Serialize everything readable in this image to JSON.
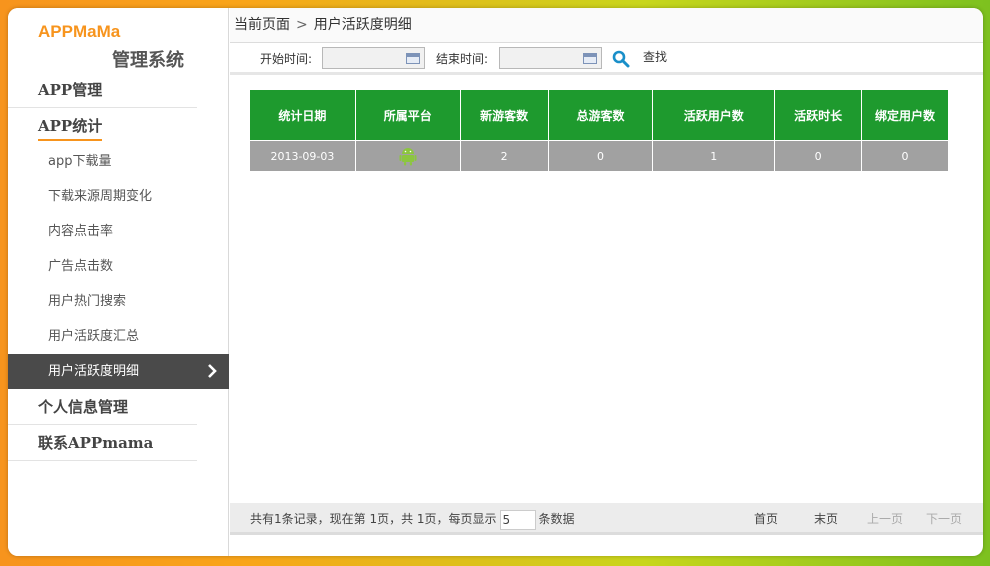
{
  "brand": {
    "en": "APPMaMa",
    "cn": "管理系统"
  },
  "sidebar": {
    "items": [
      {
        "label": "APP管理"
      },
      {
        "label": "APP统计"
      }
    ],
    "sub_items": [
      {
        "label": "app下载量"
      },
      {
        "label": "下载来源周期变化"
      },
      {
        "label": "内容点击率"
      },
      {
        "label": "广告点击数"
      },
      {
        "label": "用户热门搜索"
      },
      {
        "label": "用户活跃度汇总"
      },
      {
        "label": "用户活跃度明细"
      }
    ],
    "bottom_items": [
      {
        "label": "个人信息管理"
      },
      {
        "label": "联系APPmama"
      }
    ]
  },
  "breadcrumb": {
    "prefix": "当前页面",
    "separator": ">",
    "current": "用户活跃度明细"
  },
  "toolbar": {
    "start_label": "开始时间:",
    "start_value": "",
    "end_label": "结束时间:",
    "end_value": "",
    "search_label": "查找"
  },
  "table": {
    "headers": [
      "统计日期",
      "所属平台",
      "新游客数",
      "总游客数",
      "活跃用户数",
      "活跃时长",
      "绑定用户数"
    ],
    "rows": [
      {
        "date": "2013-09-03",
        "platform": "android-icon",
        "new_visitors": "2",
        "total_visitors": "0",
        "active_users": "1",
        "active_duration": "0",
        "bound_users": "0"
      }
    ]
  },
  "footer": {
    "info_prefix": "共有1条记录，现在第 1页，共 1页，每页显示",
    "page_size": "5",
    "info_suffix": "条数据",
    "first": "首页",
    "last": "末页",
    "prev": "上一页",
    "next": "下一页"
  },
  "colors": {
    "accent_orange": "#f7941d",
    "header_green": "#1e9a2e",
    "row_gray": "#a1a1a1",
    "active_nav": "#4a4a4a"
  }
}
